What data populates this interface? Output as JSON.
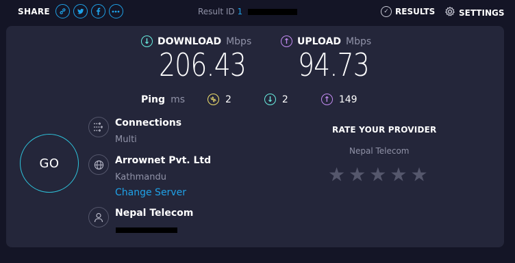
{
  "topbar": {
    "share_label": "SHARE",
    "share_icons": [
      "link-icon",
      "twitter-icon",
      "facebook-icon",
      "more-icon"
    ],
    "result_label": "Result ID",
    "result_id_visible": "1",
    "results_label": "RESULTS",
    "settings_label": "SETTINGS"
  },
  "download": {
    "label": "DOWNLOAD",
    "unit": "Mbps",
    "value": "206.43"
  },
  "upload": {
    "label": "UPLOAD",
    "unit": "Mbps",
    "value": "94.73"
  },
  "ping": {
    "label": "Ping",
    "unit": "ms",
    "jitter": "2",
    "download_latency": "2",
    "upload_latency": "149"
  },
  "go_label": "GO",
  "connections": {
    "title": "Connections",
    "sub": "Multi"
  },
  "server": {
    "title": "Arrownet Pvt. Ltd",
    "location": "Kathmandu",
    "change_label": "Change Server"
  },
  "provider": {
    "title": "Nepal Telecom"
  },
  "rate": {
    "title": "RATE YOUR PROVIDER",
    "provider": "Nepal Telecom",
    "stars": 5
  },
  "colors": {
    "background": "#141526",
    "panel": "#24263a",
    "accent_blue": "#1fa2e8",
    "download": "#6af0e2",
    "upload": "#c48cf3",
    "jitter": "#f3e26e"
  }
}
